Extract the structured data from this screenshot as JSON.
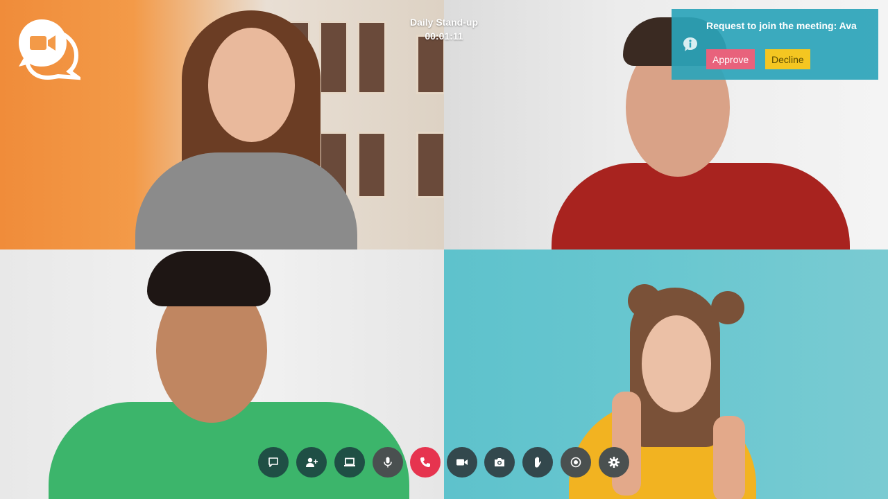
{
  "meeting": {
    "title": "Daily Stand-up",
    "elapsed": "00:01:11"
  },
  "notification": {
    "message": "Request to join the meeting: Ava",
    "approve_label": "Approve",
    "decline_label": "Decline"
  },
  "colors": {
    "toast_bg": "#2ba4ba",
    "approve": "#e8627c",
    "decline": "#f4c621",
    "end_call": "#e6344f"
  },
  "controls": [
    {
      "name": "chat-button",
      "icon": "chat-icon"
    },
    {
      "name": "add-participant-button",
      "icon": "add-user-icon"
    },
    {
      "name": "share-screen-button",
      "icon": "laptop-icon"
    },
    {
      "name": "microphone-button",
      "icon": "microphone-icon"
    },
    {
      "name": "end-call-button",
      "icon": "phone-icon"
    },
    {
      "name": "camera-toggle-button",
      "icon": "video-icon"
    },
    {
      "name": "snapshot-button",
      "icon": "camera-icon"
    },
    {
      "name": "raise-hand-button",
      "icon": "hand-icon"
    },
    {
      "name": "record-button",
      "icon": "record-icon"
    },
    {
      "name": "settings-button",
      "icon": "gear-icon"
    }
  ]
}
